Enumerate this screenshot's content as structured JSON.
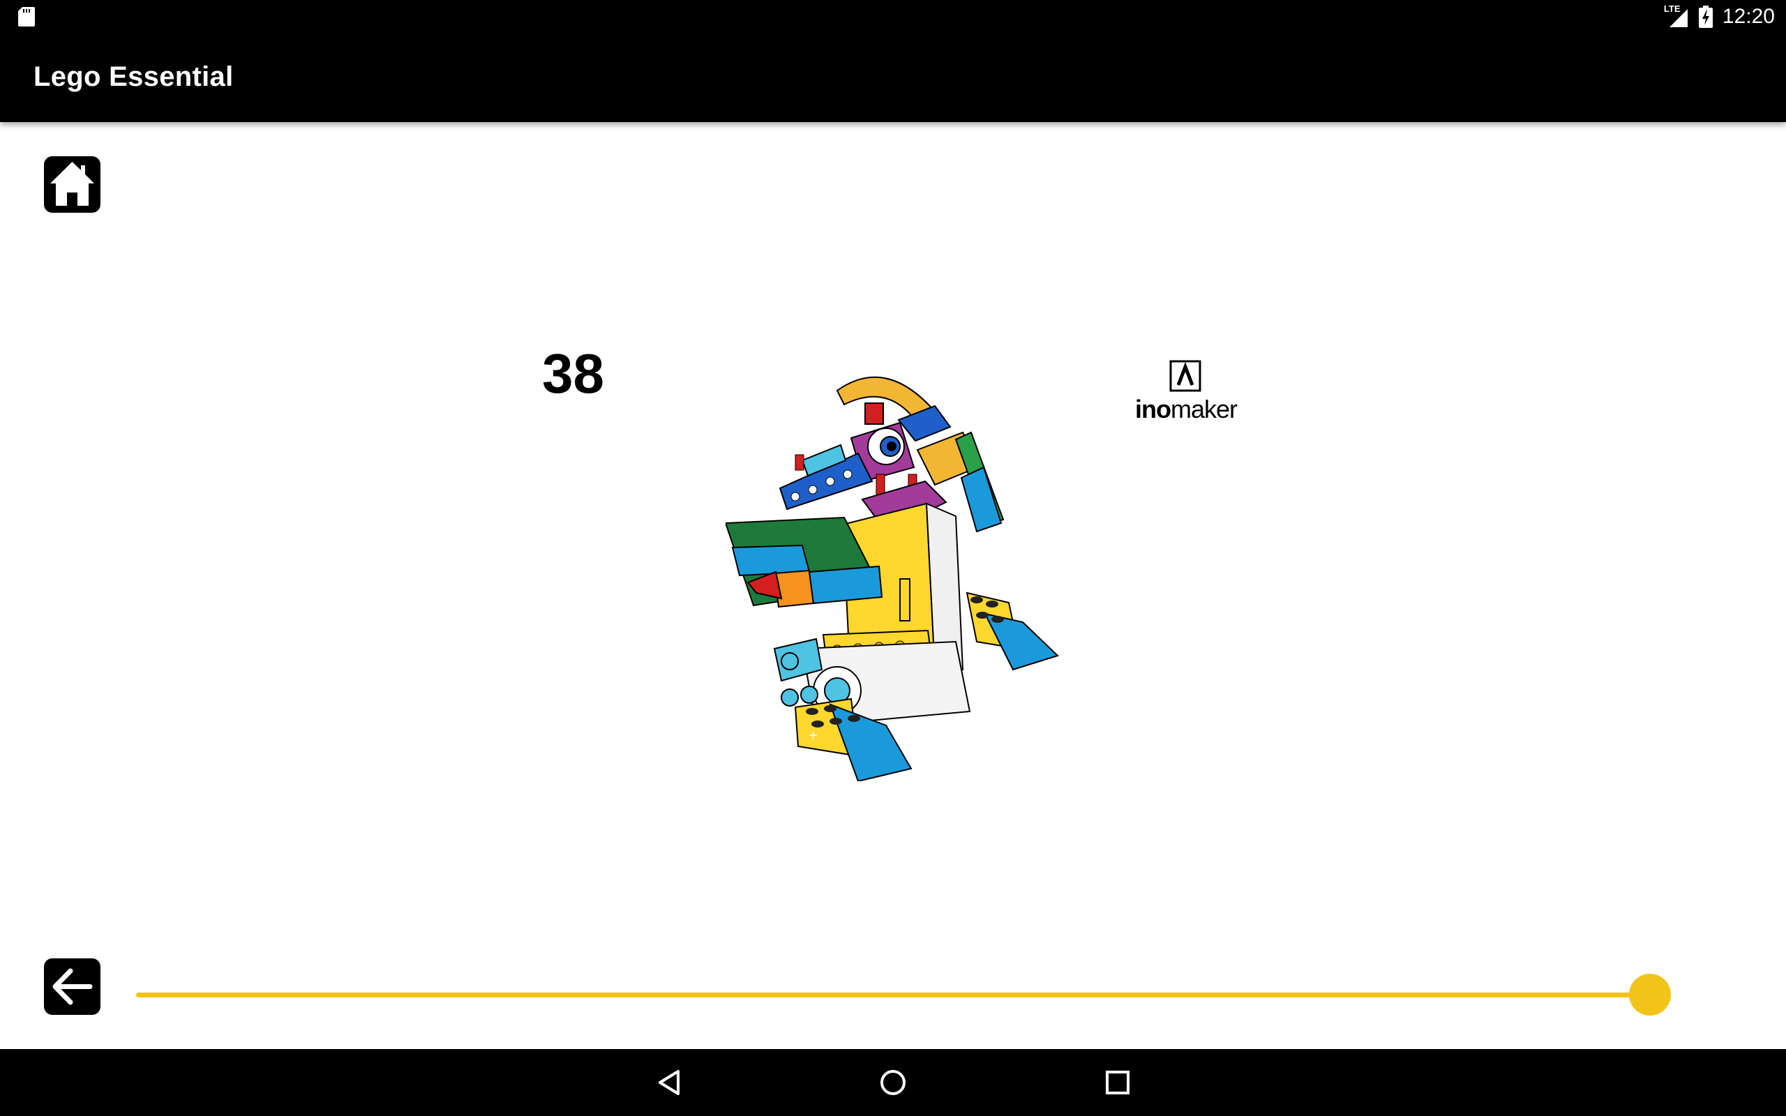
{
  "status_bar": {
    "network_label": "LTE",
    "time": "12:20",
    "icons": [
      "sd-card-icon",
      "signal-icon",
      "battery-charging-icon"
    ]
  },
  "app_bar": {
    "title": "Lego Essential"
  },
  "toolbar": {
    "home_icon": "home-icon",
    "back_icon": "arrow-left-icon"
  },
  "step": {
    "number": "38"
  },
  "logo": {
    "wordmark_bold": "ino",
    "wordmark_regular": "maker"
  },
  "slider": {
    "progress": 1.0,
    "color": "#F2C41A"
  },
  "nav_bar": {
    "icons": [
      "back-triangle-icon",
      "home-circle-icon",
      "recents-square-icon"
    ]
  },
  "colors": {
    "bar_background": "#000000",
    "accent": "#F2C41A",
    "page_background": "#FFFFFF"
  }
}
